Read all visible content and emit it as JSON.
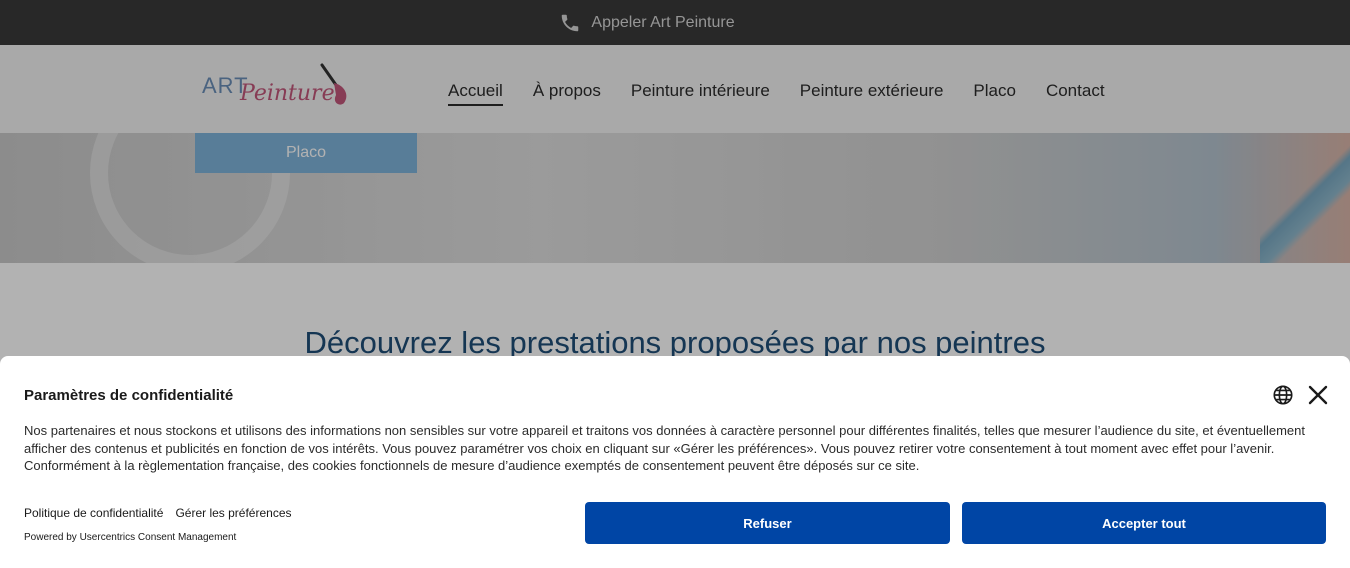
{
  "topbar": {
    "call_label": "Appeler Art Peinture",
    "icon": "phone-icon"
  },
  "logo": {
    "art": "ART",
    "peinture": "Peinture"
  },
  "nav": {
    "items": [
      {
        "label": "Accueil",
        "active": true
      },
      {
        "label": "À propos"
      },
      {
        "label": "Peinture intérieure"
      },
      {
        "label": "Peinture extérieure"
      },
      {
        "label": "Placo"
      },
      {
        "label": "Contact"
      }
    ]
  },
  "hero": {
    "button_label": "Placo"
  },
  "section": {
    "heading": "Découvrez les prestations proposées par nos peintres"
  },
  "consent": {
    "title": "Paramètres de confidentialité",
    "text": "Nos partenaires et nous stockons et utilisons des informations non sensibles sur votre appareil et traitons vos données à caractère personnel pour différentes finalités, telles que mesurer l’audience du site, et éventuellement afficher des contenus et publicités en fonction de vos intérêts. Vous pouvez paramétrer vos choix en cliquant sur «Gérer les préférences». Vous pouvez retirer votre consentement à tout moment avec effet pour l’avenir. Conformément à la règlementation française, des cookies fonctionnels de mesure d’audience exemptés de consentement peuvent être déposés sur ce site.",
    "privacy_link": "Politique de confidentialité",
    "preferences_link": "Gérer les préférences",
    "powered_by": "Powered by Usercentrics Consent Management",
    "refuse_label": "Refuser",
    "accept_label": "Accepter tout",
    "button_color": "#0045a5"
  }
}
